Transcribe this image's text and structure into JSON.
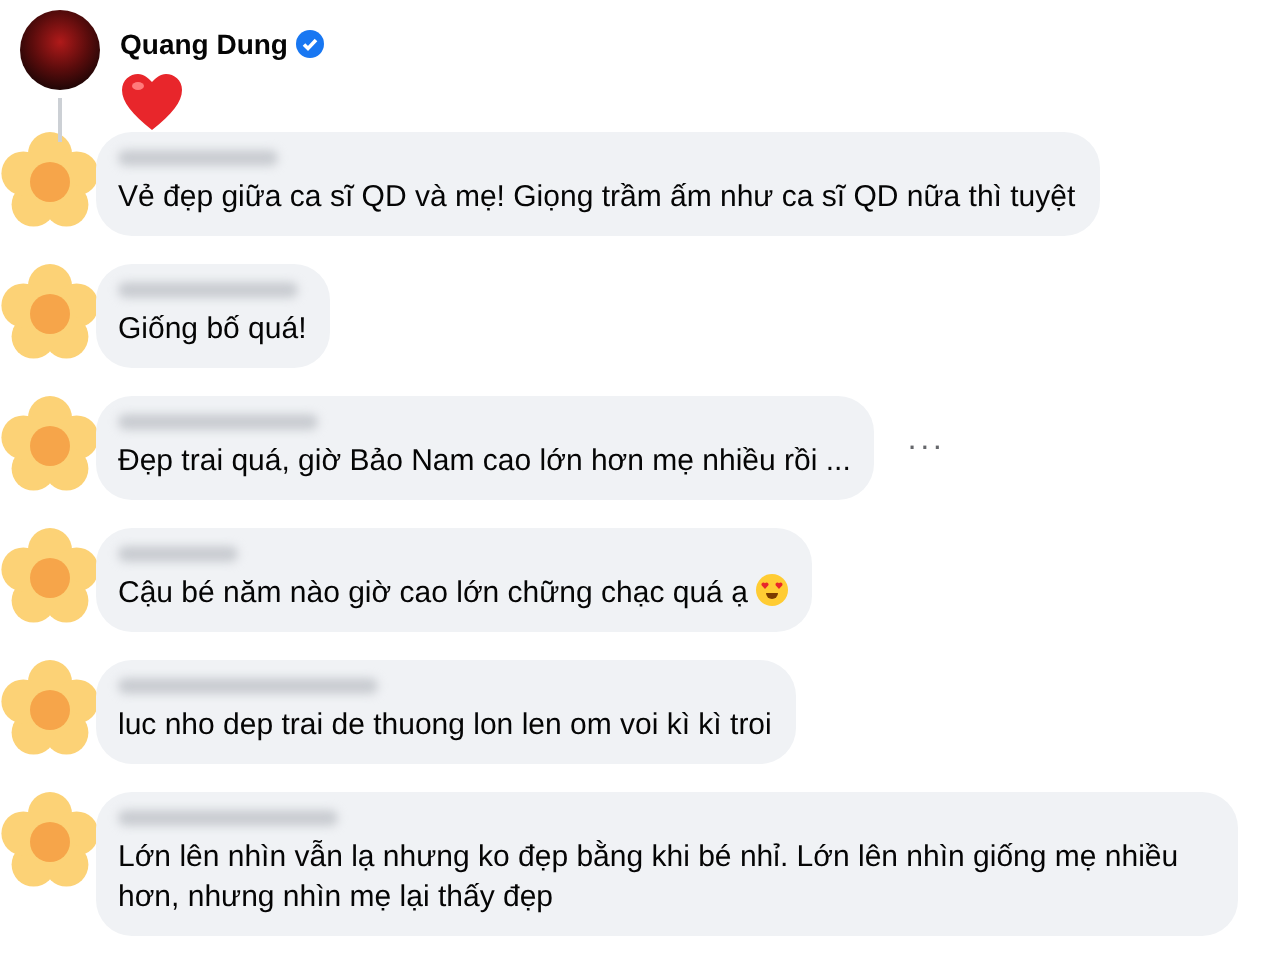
{
  "author": {
    "name": "Quang Dung",
    "verified": true,
    "sticker": {
      "kind": "heart"
    }
  },
  "comments": [
    {
      "text": "Vẻ đẹp giữa ca sĩ QD và mẹ! Giọng trầm ấm như ca sĩ QD nữa thì tuyệt"
    },
    {
      "text": "Giống bố quá!"
    },
    {
      "text": "Đẹp trai quá, giờ Bảo Nam cao lớn hơn mẹ nhiều rồi ...",
      "menu": "···"
    },
    {
      "text": "Cậu bé năm nào giờ cao lớn chững chạc quá ạ",
      "emoji": {
        "kind": "heart_eyes"
      }
    },
    {
      "text": "luc nho dep trai de thuong lon len om voi kì kì troi"
    },
    {
      "text": "Lớn lên nhìn vẫn lạ nhưng ko đẹp bằng khi bé nhỉ. Lớn lên nhìn giống mẹ nhiều hơn, nhưng nhìn mẹ lại thấy đẹp"
    }
  ]
}
